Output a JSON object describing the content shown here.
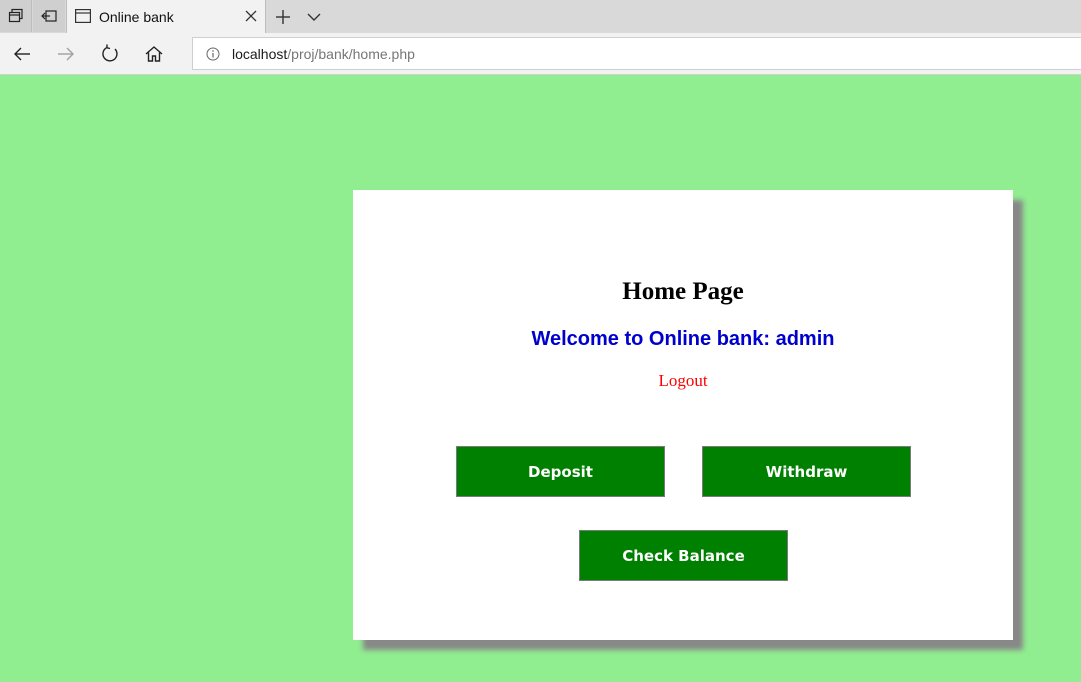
{
  "browser": {
    "tab": {
      "title": "Online bank"
    },
    "address": {
      "host": "localhost",
      "path": "/proj/bank/home.php"
    }
  },
  "page": {
    "heading": "Home Page",
    "welcome": "Welcome to Online bank: admin",
    "logout_label": "Logout",
    "buttons": {
      "deposit": "Deposit",
      "withdraw": "Withdraw",
      "check_balance": "Check Balance"
    }
  },
  "colors": {
    "page_background": "#90ee90",
    "button": "#008000",
    "welcome_text": "#0000cd",
    "logout_text": "#ff0000"
  },
  "icons": [
    "tab-actions-icon",
    "tab-back-icon",
    "page-tab-icon",
    "close-icon",
    "plus-icon",
    "chevron-down-icon",
    "back-arrow-icon",
    "forward-arrow-icon",
    "reload-icon",
    "home-icon",
    "info-icon"
  ]
}
